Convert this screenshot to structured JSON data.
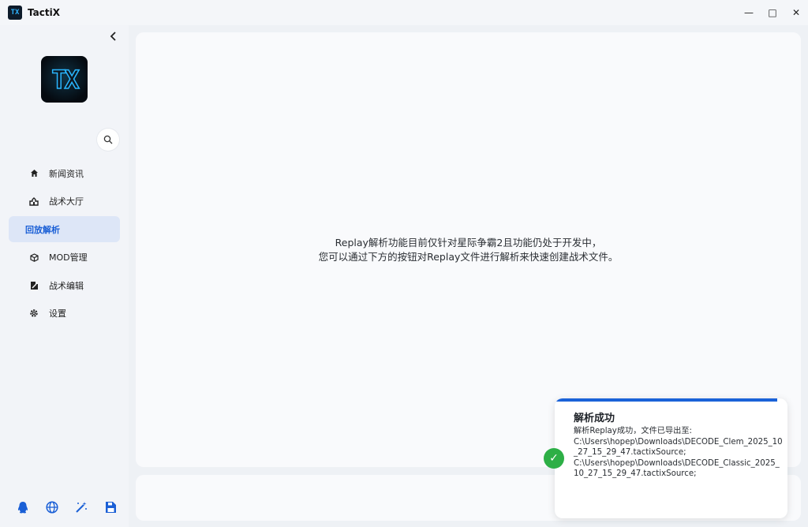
{
  "window": {
    "title": "TactiX",
    "icon_text": "TX",
    "minimize": "—",
    "maximize": "□",
    "close": "✕"
  },
  "sidebar": {
    "collapse_icon": "‹",
    "logo_text": "TX",
    "items": [
      {
        "label": "新闻资讯",
        "icon": "home-icon",
        "active": false
      },
      {
        "label": "战术大厅",
        "icon": "hall-icon",
        "active": false
      },
      {
        "label": "回放解析",
        "icon": "",
        "active": true
      },
      {
        "label": "MOD管理",
        "icon": "cube-icon",
        "active": false
      },
      {
        "label": "战术编辑",
        "icon": "edit-icon",
        "active": false
      },
      {
        "label": "设置",
        "icon": "gear-icon",
        "active": false
      }
    ],
    "bottom_icons": [
      "qq-icon",
      "globe-icon",
      "magic-wand-icon",
      "save-icon"
    ]
  },
  "main": {
    "line1": "Replay解析功能目前仅针对星际争霸2且功能仍处于开发中，",
    "line2": "您可以通过下方的按钮对Replay文件进行解析来快速创建战术文件。"
  },
  "toast": {
    "title": "解析成功",
    "message": "解析Replay成功，文件已导出至:",
    "path1": "C:\\Users\\hopep\\Downloads\\DECODE_Clem_2025_10_27_15_29_47.tactixSource;",
    "path2": "C:\\Users\\hopep\\Downloads\\DECODE_Classic_2025_10_27_15_29_47.tactixSource;",
    "status_color": "#2daf46",
    "accent_color": "#1a62d8"
  }
}
